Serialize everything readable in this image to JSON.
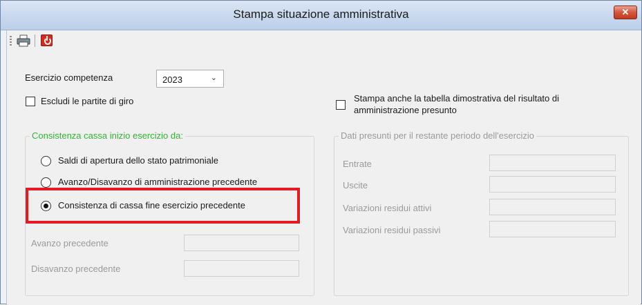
{
  "window": {
    "title": "Stampa situazione amministrativa",
    "close_glyph": "✕"
  },
  "toolbar": {
    "items": [
      "printer-icon",
      "stop-icon"
    ]
  },
  "form": {
    "esercizio_label": "Esercizio competenza",
    "esercizio_value": "2023",
    "escludi_label": "Escludi le partite di giro",
    "escludi_checked": false,
    "stampa_label_line1": "Stampa anche la tabella dimostrativa del risultato di",
    "stampa_label_line2": "amministrazione presunto",
    "stampa_checked": false
  },
  "consistenza": {
    "legend": "Consistenza cassa inizio esercizio da:",
    "legend_color": "#32b432",
    "options": [
      {
        "label": "Saldi di apertura dello stato patrimoniale",
        "selected": false
      },
      {
        "label": "Avanzo/Disavanzo di amministrazione precedente",
        "selected": false
      },
      {
        "label": "Consistenza di cassa fine esercizio precedente",
        "selected": true
      }
    ],
    "avanzo_label": "Avanzo precedente",
    "disavanzo_label": "Disavanzo precedente"
  },
  "presunti": {
    "legend": "Dati presunti per il restante periodo dell'esercizio",
    "fields": [
      "Entrate",
      "Uscite",
      "Variazioni residui attivi",
      "Variazioni residui passivi"
    ]
  },
  "colors": {
    "highlight": "#e31c23"
  }
}
